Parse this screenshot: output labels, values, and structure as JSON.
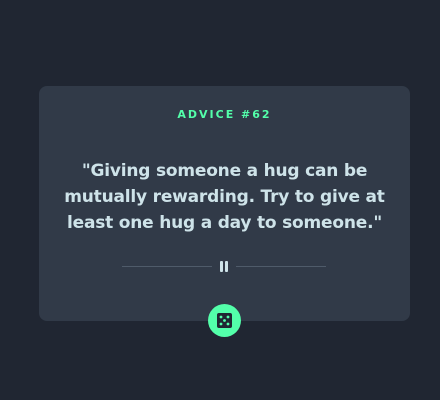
{
  "card": {
    "label": "ADVICE #62",
    "quote": "\"Giving someone a hug can be mutually rewarding. Try to give at least one hug a day to someone.\""
  },
  "divider": {
    "icon": "pause-icon"
  },
  "dice_button": {
    "icon": "dice-icon"
  },
  "colors": {
    "background": "#202632",
    "card": "#313a48",
    "accent": "#53ffaa",
    "text": "#cee3e9",
    "divider": "#4f5b6a"
  }
}
